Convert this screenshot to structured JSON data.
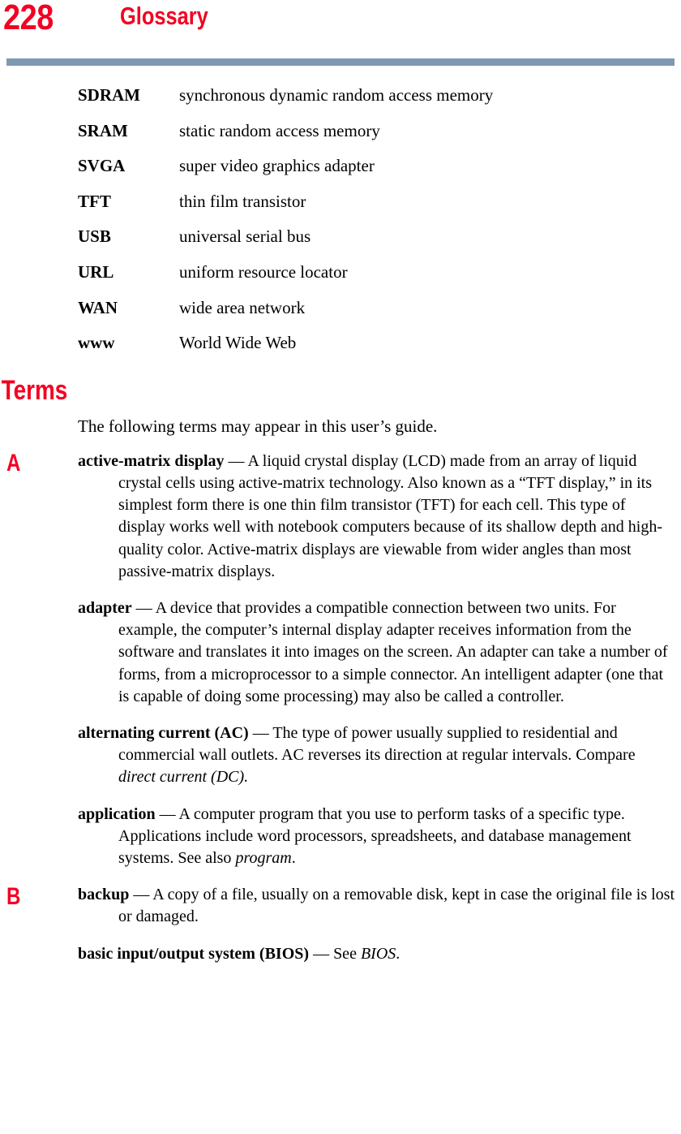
{
  "header": {
    "page_number": "228",
    "chapter_title": "Glossary",
    "rule_color": "#7f99b3",
    "accent_color": "#f30022"
  },
  "acronyms": [
    {
      "term": "SDRAM",
      "definition": "synchronous dynamic random access memory"
    },
    {
      "term": "SRAM",
      "definition": "static random access memory"
    },
    {
      "term": "SVGA",
      "definition": "super video graphics adapter"
    },
    {
      "term": "TFT",
      "definition": "thin film transistor"
    },
    {
      "term": "USB",
      "definition": "universal serial bus"
    },
    {
      "term": "URL",
      "definition": "uniform resource locator"
    },
    {
      "term": "WAN",
      "definition": "wide area network"
    },
    {
      "term": "www",
      "definition": "World Wide Web"
    }
  ],
  "terms_section": {
    "heading": "Terms",
    "intro": "The following terms may appear in this user’s guide.",
    "letter_markers": {
      "a": "A",
      "b": "B"
    },
    "entries": [
      {
        "letter": "A",
        "term": "active-matrix display",
        "dash": " — ",
        "body": "A liquid crystal display (LCD) made from an array of liquid crystal cells using active-matrix technology. Also known as a “TFT display,” in its simplest form there is one thin film transistor (TFT) for each cell. This type of display works well with notebook computers because of its shallow depth and high-quality color. Active-matrix displays are viewable from wider angles than most passive-matrix displays."
      },
      {
        "term": "adapter",
        "dash": " — ",
        "body": "A device that provides a compatible connection between two units. For example, the computer’s internal display adapter receives information from the software and translates it into images on the screen. An adapter can take a number of forms, from a microprocessor to a simple connector. An intelligent adapter (one that is capable of doing some processing) may also be called a controller."
      },
      {
        "term": "alternating current (AC)",
        "dash": " — ",
        "body": "The type of power usually supplied to residential and commercial wall outlets. AC reverses its direction at regular intervals. Compare ",
        "emphasis": "direct current (DC).",
        "body_after": ""
      },
      {
        "term": "application",
        "dash": " — ",
        "body": "A computer program that you use to perform tasks of a specific type. Applications include word processors, spreadsheets, and database management systems. See also ",
        "emphasis": "program",
        "body_after": "."
      },
      {
        "letter": "B",
        "term": "backup",
        "dash": " — ",
        "body": "A copy of a file, usually on a removable disk, kept in case the original file is lost or damaged."
      },
      {
        "term": "basic input/output system (BIOS)",
        "dash": " — ",
        "body": "See ",
        "emphasis": "BIOS",
        "body_after": "."
      }
    ]
  }
}
